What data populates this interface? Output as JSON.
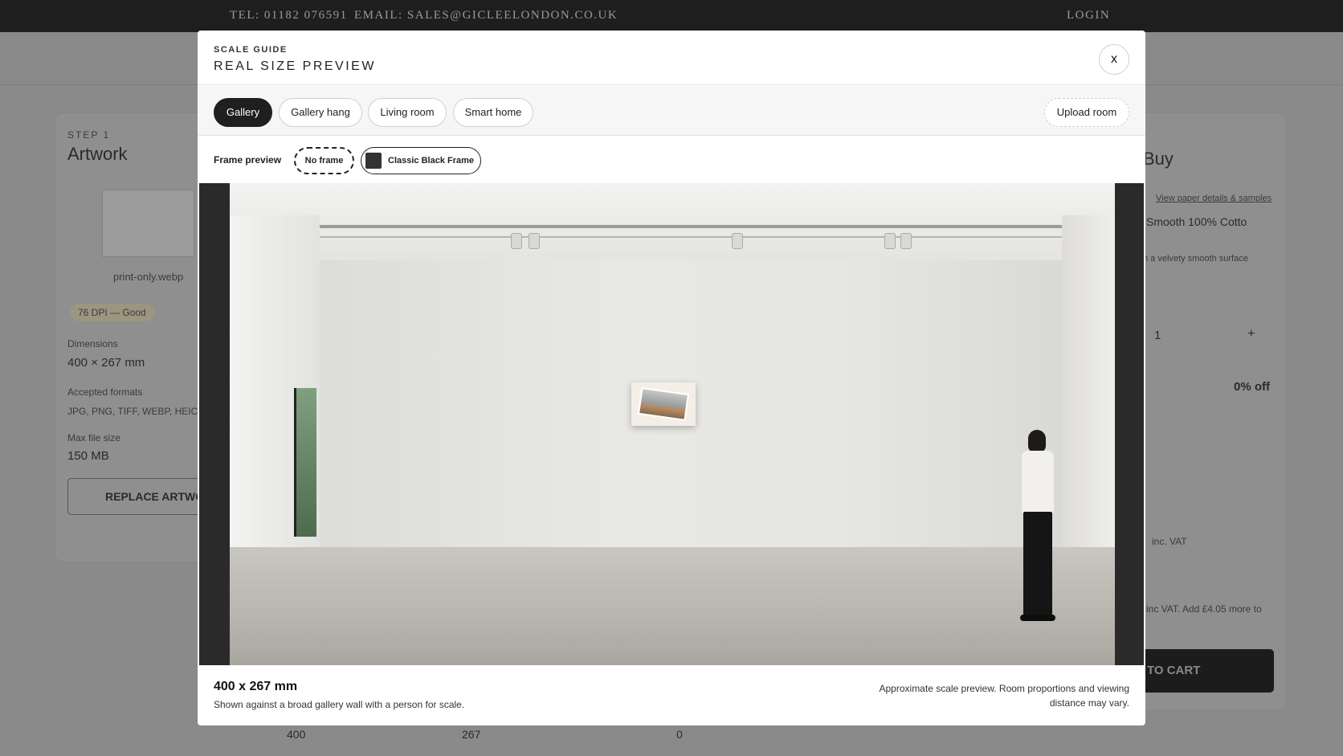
{
  "topbar": {
    "tel": "TEL: 01182 076591",
    "email": "EMAIL: SALES@GICLEELONDON.CO.UK",
    "login": "LOGIN"
  },
  "background": {
    "step_label": "STEP 1",
    "step_title": "Artwork",
    "file_name": "print-only.webp",
    "dpi_badge": "76 DPI — Good",
    "dimensions_label": "Dimensions",
    "dimensions_value": "400 × 267 mm",
    "formats_label": "Accepted formats",
    "formats_value": "JPG, PNG, TIFF, WEBP, HEIC, P",
    "maxsize_label": "Max file size",
    "maxsize_value": "150 MB",
    "replace_button": "REPLACE ARTWO",
    "buy_title": "Buy",
    "paper_link": "View paper details & samples",
    "paper_select": "Smooth 100% Cotto",
    "paper_desc": "h a velvety smooth surface",
    "quantity": "1",
    "plus": "+",
    "discount": "0% off",
    "vat_text": "inc. VAT",
    "shipping_text": "inc VAT. Add £4.05 more to",
    "cart_button": "TO CART",
    "width_input": "400",
    "height_input": "267",
    "offset_input": "0"
  },
  "modal": {
    "eyebrow": "SCALE GUIDE",
    "title": "REAL SIZE PREVIEW",
    "close": "x",
    "tabs": [
      {
        "label": "Gallery",
        "active": true
      },
      {
        "label": "Gallery hang",
        "active": false
      },
      {
        "label": "Living room",
        "active": false
      },
      {
        "label": "Smart home",
        "active": false
      }
    ],
    "upload_room": "Upload room",
    "frame_preview_label": "Frame preview",
    "frame_options": [
      {
        "label": "No frame",
        "selected": true
      },
      {
        "label": "Classic Black Frame",
        "selected": false
      }
    ],
    "size_label": "400 x 267 mm",
    "size_desc": "Shown against a broad gallery wall with a person for scale.",
    "note": "Approximate scale preview. Room proportions and viewing distance may vary."
  }
}
